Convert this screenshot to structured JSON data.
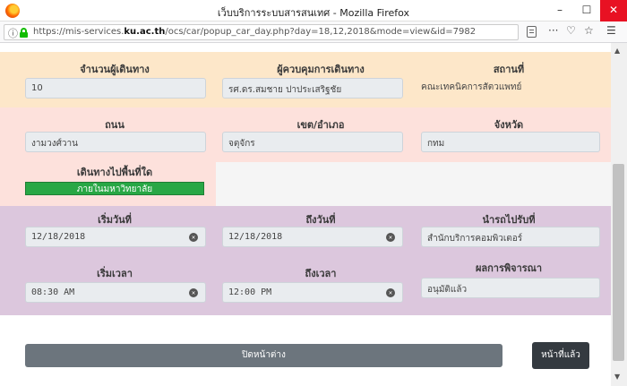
{
  "window": {
    "title": "เว็บบริการระบบสารสนเทศ - Mozilla Firefox",
    "minimize": "–",
    "maximize": "☐",
    "close": "✕"
  },
  "urlbar": {
    "prefix": "https://mis-services.",
    "domain": "ku.ac.th",
    "path": "/ocs/car/popup_car_day.php?day=18,12,2018&mode=view&id=7982",
    "more": "···",
    "pocket": "♡",
    "star": "☆",
    "menu": "☰"
  },
  "row1": {
    "passengers_label": "จำนวนผู้เดินทาง",
    "passengers_value": "10",
    "controller_label": "ผู้ควบคุมการเดินทาง",
    "controller_value": "รศ.ดร.สมชาย ปาประเสริฐชัย",
    "place_label": "สถานที่",
    "place_value": "คณะเทคนิคการสัตวแพทย์"
  },
  "row2": {
    "road_label": "ถนน",
    "road_value": "งามวงศ์วาน",
    "district_label": "เขต/อำเภอ",
    "district_value": "จตุจักร",
    "province_label": "จังหวัด",
    "province_value": "กทม"
  },
  "row3": {
    "area_label": "เดินทางไปพื้นที่ใด",
    "area_value": "ภายในมหาวิทยาลัย"
  },
  "row4": {
    "start_date_label": "เริ่มวันที่",
    "start_date_value": "12/18/2018",
    "end_date_label": "ถึงวันที่",
    "end_date_value": "12/18/2018",
    "source_label": "นำรถไปรับที่",
    "source_value": "สำนักบริการคอมพิวเตอร์"
  },
  "row5": {
    "start_time_label": "เริ่มเวลา",
    "start_time_value": "08:30 AM",
    "end_time_label": "ถึงเวลา",
    "end_time_value": "12:00 PM",
    "result_label": "ผลการพิจารณา",
    "result_value": "อนุมัติแล้ว"
  },
  "actions": {
    "close_label": "ปิดหน้าต่าง",
    "prev_label": "หน้าที่แล้ว"
  },
  "clear_symbol": "✕",
  "colors": {
    "band_orange": "#fde7c9",
    "band_pink": "#fde1dc",
    "band_purple": "#dcc7dd",
    "badge_green": "#28a745"
  }
}
